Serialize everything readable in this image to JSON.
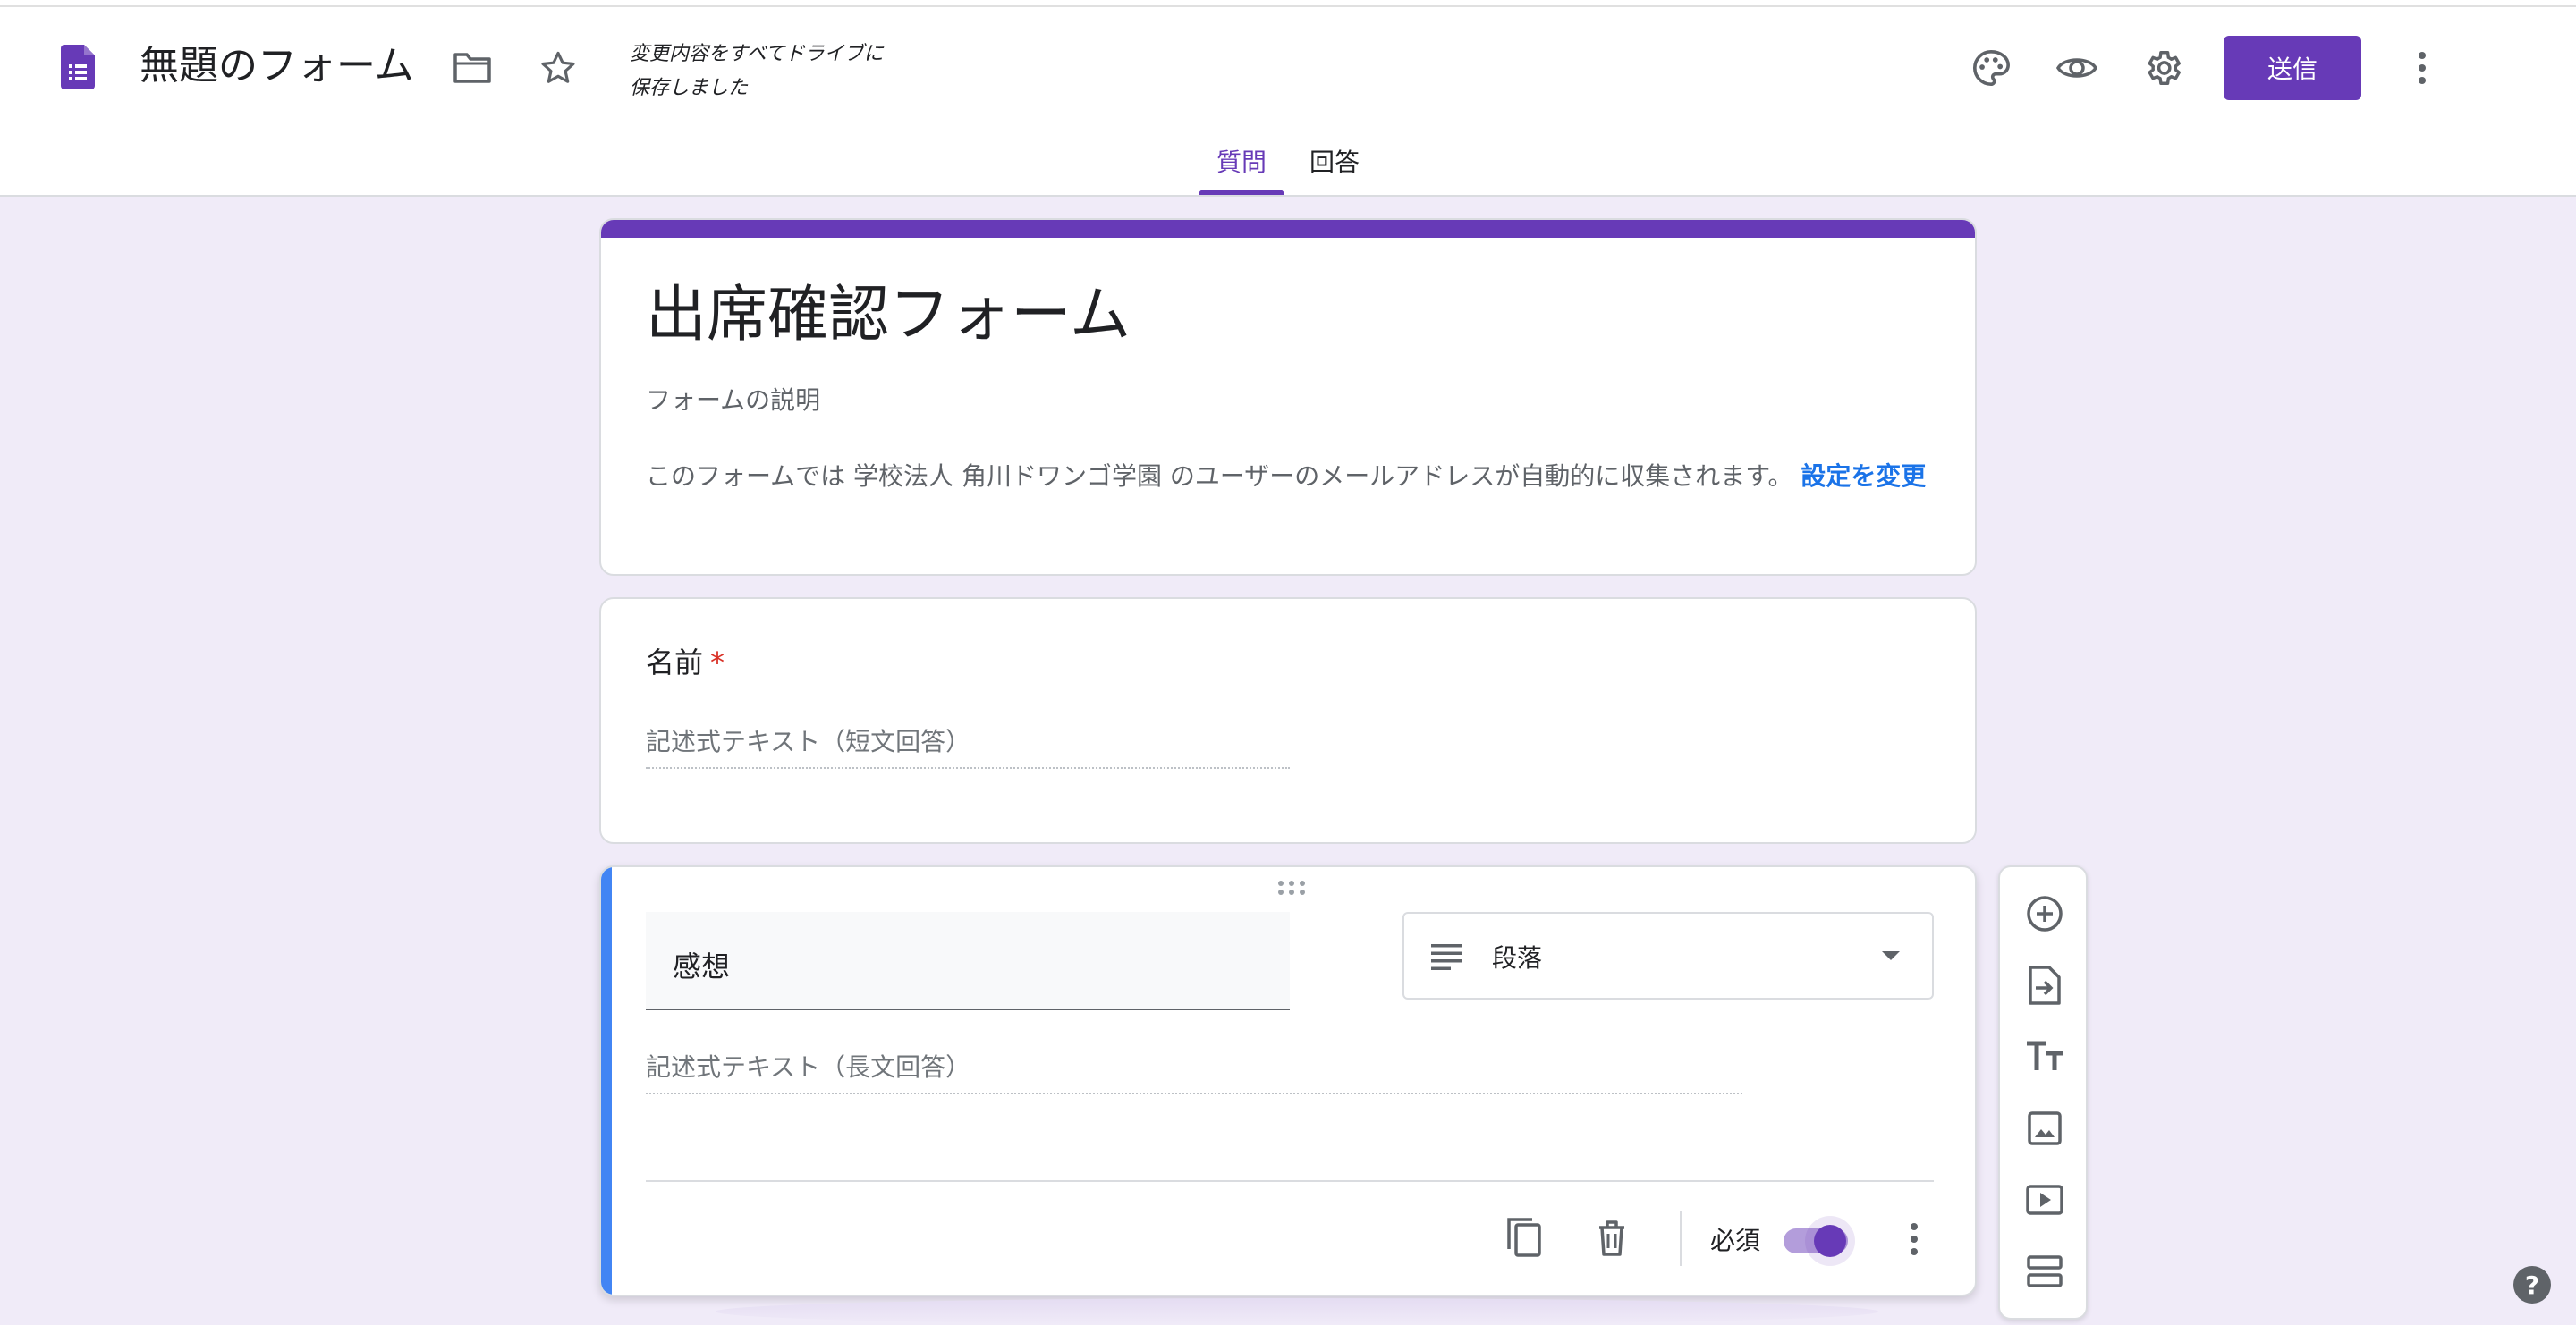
{
  "header": {
    "doc_title": "無題のフォーム",
    "save_status": "変更内容をすべてドライブに\n保存しました",
    "send_label": "送信",
    "icons": [
      "forms-app-icon",
      "folder-icon",
      "star-icon",
      "palette-icon",
      "preview-eye-icon",
      "settings-gear-icon",
      "more-vert-icon"
    ],
    "tabs": [
      {
        "label": "質問",
        "active": true
      },
      {
        "label": "回答",
        "active": false
      }
    ]
  },
  "form": {
    "title": "出席確認フォーム",
    "description_placeholder": "フォームの説明",
    "email_notice": "このフォームでは 学校法人 角川ドワンゴ学園 のユーザーのメールアドレスが自動的に収集されます。",
    "email_notice_link": "設定を変更",
    "accent_color": "#673ab7",
    "background_color": "#f0ebf8"
  },
  "questions": [
    {
      "title": "名前",
      "required_mark": "*",
      "answer_placeholder": "記述式テキスト（短文回答）"
    },
    {
      "title": "感想",
      "type_label": "段落",
      "answer_placeholder": "記述式テキスト（長文回答）",
      "required_label": "必須",
      "required": true
    }
  ],
  "side_toolbar": {
    "items": [
      "add-question-icon",
      "import-questions-icon",
      "add-title-icon",
      "add-image-icon",
      "add-video-icon",
      "add-section-icon"
    ]
  },
  "help": {
    "label": "?"
  }
}
